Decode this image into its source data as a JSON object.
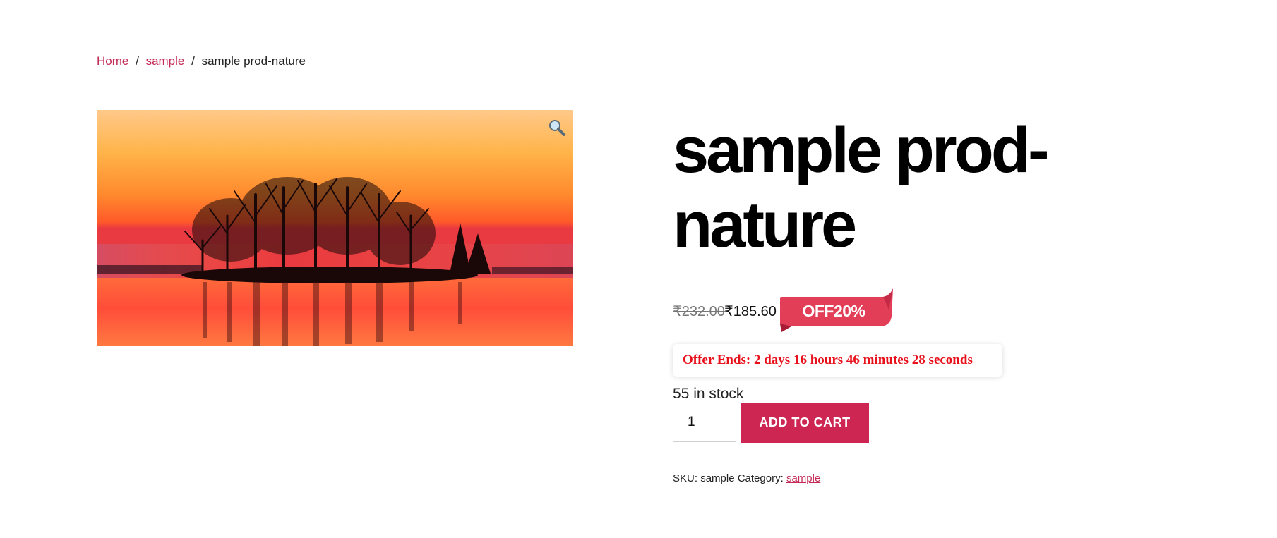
{
  "breadcrumb": {
    "home": "Home",
    "separator": "/",
    "category": "sample",
    "current": "sample prod-nature"
  },
  "product": {
    "title": "sample prod-nature",
    "image_subject": "sunset island with tree silhouettes reflected in water",
    "zoom_icon": "magnifier-icon",
    "price_old": "₹232.00",
    "price_new": "₹185.60",
    "discount_badge": "OFF20%",
    "offer_text": "Offer Ends: 2 days 16 hours 46 minutes 28 seconds",
    "stock": "55 in stock",
    "quantity": "1",
    "add_to_cart_label": "ADD TO CART",
    "sku_label": "SKU:",
    "sku_value": "sample",
    "category_label": "Category:",
    "category_value": "sample"
  },
  "colors": {
    "accent": "#cd2653",
    "link": "#c32a55",
    "badge": "#e23e57",
    "offer_text": "#e8101a"
  }
}
